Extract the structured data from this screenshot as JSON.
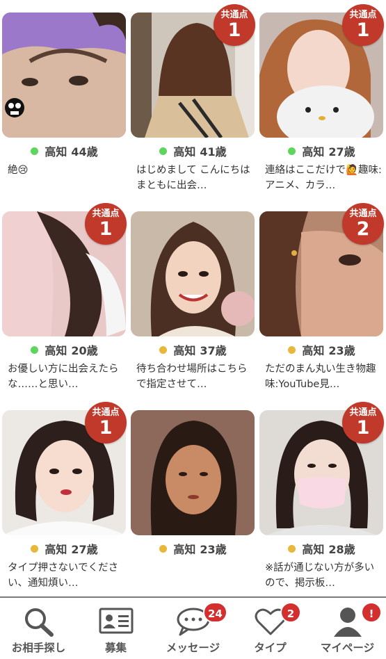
{
  "colors": {
    "online": "#5cd65c",
    "recent": "#e8b83a",
    "badge": "#c0392b"
  },
  "common_label": "共通点",
  "cards": [
    {
      "city": "高知",
      "age": "44歳",
      "status": "online",
      "common": null,
      "message": "絶😢",
      "photo": "purple"
    },
    {
      "city": "高知",
      "age": "41歳",
      "status": "online",
      "common": "1",
      "message": "はじめまして こんにちはまともに出会…",
      "photo": "apron"
    },
    {
      "city": "高知",
      "age": "27歳",
      "status": "online",
      "common": "1",
      "message": "連絡はここだけで🙋趣味:アニメ、カラ…",
      "photo": "plush"
    },
    {
      "city": "高知",
      "age": "20歳",
      "status": "online",
      "common": "1",
      "message": "お優しい方に出会えたらな……と思い…",
      "photo": "pink"
    },
    {
      "city": "高知",
      "age": "37歳",
      "status": "recent",
      "common": null,
      "message": "待ち合わせ場所はこちらで指定させて…",
      "photo": "smile"
    },
    {
      "city": "高知",
      "age": "23歳",
      "status": "recent",
      "common": "2",
      "message": "ただのまん丸い生き物趣味:YouTube見…",
      "photo": "coffee"
    },
    {
      "city": "高知",
      "age": "27歳",
      "status": "recent",
      "common": "1",
      "message": "タイプ押さないでください、通知煩い…",
      "photo": "bob"
    },
    {
      "city": "高知",
      "age": "23歳",
      "status": "recent",
      "common": null,
      "message": "",
      "photo": "mosaic"
    },
    {
      "city": "高知",
      "age": "28歳",
      "status": "recent",
      "common": "1",
      "message": "※話が通じない方が多いので、掲示板…",
      "photo": "mask"
    }
  ],
  "tabs": [
    {
      "label": "お相手探し",
      "icon": "search-icon",
      "badge": null
    },
    {
      "label": "募集",
      "icon": "id-card-icon",
      "badge": null
    },
    {
      "label": "メッセージ",
      "icon": "chat-bubble-icon",
      "badge": "24"
    },
    {
      "label": "タイプ",
      "icon": "heart-icon",
      "badge": "2"
    },
    {
      "label": "マイページ",
      "icon": "person-icon",
      "badge": "!"
    }
  ]
}
